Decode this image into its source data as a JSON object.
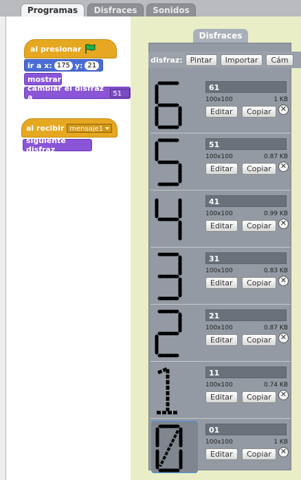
{
  "tabs": [
    {
      "label": "Programas",
      "active": true
    },
    {
      "label": "Disfraces",
      "active": false
    },
    {
      "label": "Sonidos",
      "active": false
    }
  ],
  "scripts": {
    "script1": {
      "hat_label": "al presionar",
      "goto_label": "ir a x:",
      "goto_x": "175",
      "goto_y_label": "y:",
      "goto_y": "21",
      "show_label": "mostrar",
      "switch_label": "cambiar el disfraz a",
      "switch_value": "51"
    },
    "script2": {
      "hat_label": "al recibir",
      "message": "mensaje1",
      "next_label": "siguiente disfraz"
    }
  },
  "costumes_panel": {
    "tab_label": "Disfraces",
    "costume_label": "disfraz:",
    "paint_label": "Pintar",
    "import_label": "Importar",
    "camera_label": "Cám",
    "edit_label": "Editar",
    "copy_label": "Copiar",
    "delete_symbol": "✕",
    "items": [
      {
        "name": "61",
        "dims": "100x100",
        "size": "1 KB",
        "digit": "6",
        "selected": false
      },
      {
        "name": "51",
        "dims": "100x100",
        "size": "0.87 KB",
        "digit": "5",
        "selected": false
      },
      {
        "name": "41",
        "dims": "100x100",
        "size": "0.99 KB",
        "digit": "4",
        "selected": false
      },
      {
        "name": "31",
        "dims": "100x100",
        "size": "0.83 KB",
        "digit": "3",
        "selected": false
      },
      {
        "name": "21",
        "dims": "100x100",
        "size": "0.87 KB",
        "digit": "2",
        "selected": false
      },
      {
        "name": "11",
        "dims": "100x100",
        "size": "0.74 KB",
        "digit": "1",
        "selected": false
      },
      {
        "name": "01",
        "dims": "100x100",
        "size": "1 KB",
        "digit": "0",
        "selected": true
      }
    ]
  },
  "colors": {
    "control": "#e6a821",
    "motion": "#4a6cd4",
    "looks": "#8a55d7",
    "flag": "#22b14c"
  }
}
